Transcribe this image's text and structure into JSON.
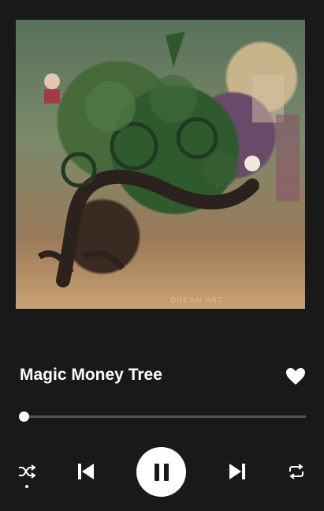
{
  "track": {
    "title": "Magic Money Tree",
    "liked": true
  },
  "artwork": {
    "signature_text": "DREAM ART",
    "alt": "album artwork"
  },
  "progress": {
    "fraction": 0.0
  },
  "controls": {
    "shuffle_icon": "shuffle-icon",
    "shuffle_active": true,
    "previous_icon": "skip-previous-icon",
    "play_state": "playing",
    "pause_icon": "pause-icon",
    "next_icon": "skip-next-icon",
    "repeat_icon": "repeat-icon"
  },
  "colors": {
    "background": "#191919",
    "text": "#ffffff",
    "track": "#555555",
    "accent": "#ffffff"
  }
}
